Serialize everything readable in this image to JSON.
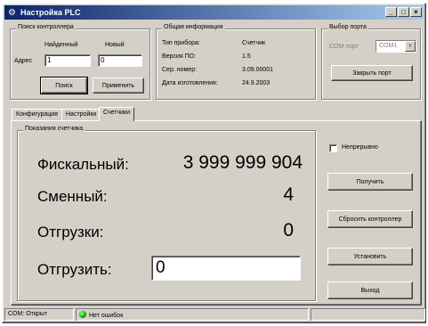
{
  "window": {
    "title": "Настройка PLC",
    "controls": [
      "_",
      "□",
      "×"
    ]
  },
  "search": {
    "legend": "Поиск контроллера",
    "found_label": "Найденный",
    "new_label": "Новый",
    "address_label": "Адрес",
    "found_value": "1",
    "new_value": "0",
    "search_button": "Поиск",
    "apply_button": "Применить"
  },
  "info": {
    "legend": "Общая информация",
    "rows": [
      {
        "label": "Тип прибора:",
        "value": "Счетчик"
      },
      {
        "label": "Версия ПО:",
        "value": "1.5"
      },
      {
        "label": "Сер. номер:",
        "value": "3.09.00001"
      },
      {
        "label": "Дата изготовления:",
        "value": "24.9.2003"
      }
    ]
  },
  "port": {
    "legend": "Выбор порта",
    "port_label": "COM порт",
    "port_value": "COM1",
    "close_button": "Закрыть порт"
  },
  "tabs": [
    {
      "label": "Конфигурация",
      "active": false
    },
    {
      "label": "Настройки",
      "active": false
    },
    {
      "label": "Счетчики",
      "active": true
    }
  ],
  "counters": {
    "legend": "Показания счетчика",
    "fiscal_label": "Фискальный:",
    "fiscal_value": "3 999 999 904",
    "shift_label": "Сменный:",
    "shift_value": "4",
    "shipments_label": "Отгрузки:",
    "shipments_value": "0",
    "ship_label": "Отгрузить:",
    "ship_input": "0"
  },
  "actions": {
    "continuous_label": "Непрерывно",
    "continuous_checked": false,
    "get_button": "Получить",
    "reset_button": "Сбросить контроллер",
    "set_button": "Установить",
    "exit_button": "Выход"
  },
  "status": {
    "port": "COM: Открыт",
    "errors": "Нет ошибок"
  }
}
